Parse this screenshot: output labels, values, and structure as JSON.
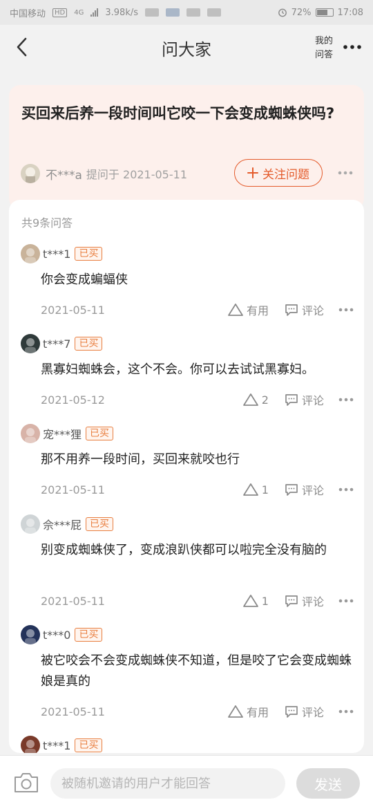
{
  "status_bar": {
    "carrier": "中国移动",
    "network_badge": "HD",
    "network_type": "4G",
    "speed": "3.98k/s",
    "battery": "72%",
    "battery_level": 0.72,
    "time": "17:08"
  },
  "nav": {
    "title": "问大家",
    "my_qa_line1": "我的",
    "my_qa_line2": "问答"
  },
  "question": {
    "title": "买回来后养一段时间叫它咬一下会变成蜘蛛侠吗?",
    "asker": "不***a",
    "asked_on": "提问于 2021-05-11",
    "follow_label": "关注问题"
  },
  "answers_header": {
    "count_label": "共9条问答"
  },
  "answers": [
    {
      "user": "t***1",
      "tag": "已买",
      "text": "你会变成蝙蝠侠",
      "date": "2021-05-11",
      "useful": "有用",
      "comment": "评论",
      "avatar_color": "#c9b39a"
    },
    {
      "user": "t***7",
      "tag": "已买",
      "text": "黑寡妇蜘蛛会，这个不会。你可以去试试黑寡妇。",
      "date": "2021-05-12",
      "useful": "2",
      "comment": "评论",
      "avatar_color": "#2f3a3a"
    },
    {
      "user": "宠***狸",
      "tag": "已买",
      "text": "那不用养一段时间，买回来就咬也行",
      "date": "2021-05-11",
      "useful": "1",
      "comment": "评论",
      "avatar_color": "#d8b3a8"
    },
    {
      "user": "佘***屁",
      "tag": "已买",
      "text": "别变成蜘蛛侠了，变成浪趴侠都可以啦完全没有脑的",
      "date": "2021-05-11",
      "useful": "1",
      "comment": "评论",
      "avatar_color": "#cfd4d6"
    },
    {
      "user": "t***0",
      "tag": "已买",
      "text": "被它咬会不会变成蜘蛛侠不知道，但是咬了它会变成蜘蛛娘是真的",
      "date": "2021-05-11",
      "useful": "有用",
      "comment": "评论",
      "avatar_color": "#24335a"
    },
    {
      "user": "t***1",
      "tag": "已买",
      "text": "",
      "date": "",
      "useful": "",
      "comment": "",
      "avatar_color": "#7a3a2a"
    }
  ],
  "bottom_bar": {
    "input_placeholder": "被随机邀请的用户才能回答",
    "send_label": "发送"
  },
  "colors": {
    "accent": "#e45a2a",
    "tag": "#e87d3e",
    "card_bg": "#fdf0ec"
  },
  "icons": [
    "back-arrow-icon",
    "more-dots-icon",
    "plus-icon",
    "thumbs-triangle-icon",
    "comment-bubble-icon",
    "camera-icon"
  ]
}
